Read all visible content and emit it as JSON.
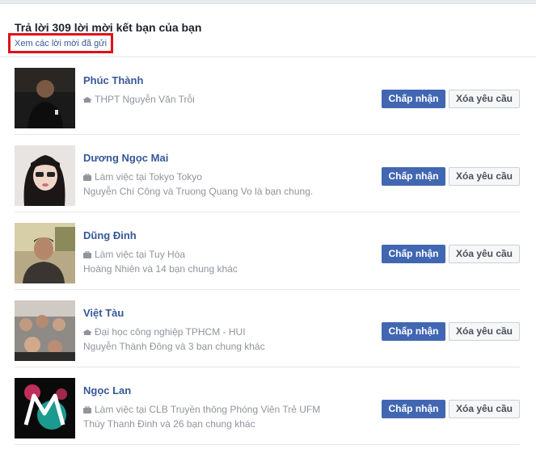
{
  "header": {
    "title": "Trả lời 309 lời mời kết bạn của bạn",
    "sent_requests_link": "Xem các lời mời đã gửi"
  },
  "colors": {
    "link": "#365899",
    "accept_button": "#4267b2",
    "highlight_box": "#e0101a",
    "secondary_text": "#90949c"
  },
  "requests": [
    {
      "name": "Phúc Thành",
      "info_icon": "school-icon",
      "info": "THPT Nguyễn Văn Trỗi",
      "mutual": "",
      "accept_label": "Chấp nhận",
      "delete_label": "Xóa yêu cầu"
    },
    {
      "name": "Dương Ngọc Mai",
      "info_icon": "briefcase-icon",
      "info": "Làm việc tại Tokyo Tokyo",
      "mutual": "Nguyễn Chí Công và Truong Quang Vo là bạn chung.",
      "accept_label": "Chấp nhận",
      "delete_label": "Xóa yêu cầu"
    },
    {
      "name": "Dũng Đinh",
      "info_icon": "briefcase-icon",
      "info": "Làm việc tại Tuy Hòa",
      "mutual": "Hoàng Nhiên và 14 bạn chung khác",
      "accept_label": "Chấp nhận",
      "delete_label": "Xóa yêu cầu"
    },
    {
      "name": "Việt Tàu",
      "info_icon": "school-icon",
      "info": "Đại học công nghiệp TPHCM - HUI",
      "mutual": "Nguyễn Thành Đông và 3 bạn chung khác",
      "accept_label": "Chấp nhận",
      "delete_label": "Xóa yêu cầu"
    },
    {
      "name": "Ngọc Lan",
      "info_icon": "briefcase-icon",
      "info": "Làm việc tại CLB Truyền thông Phóng Viên Trẻ UFM",
      "mutual": "Thúy Thanh Đinh và 26 bạn chung khác",
      "accept_label": "Chấp nhận",
      "delete_label": "Xóa yêu cầu"
    }
  ]
}
